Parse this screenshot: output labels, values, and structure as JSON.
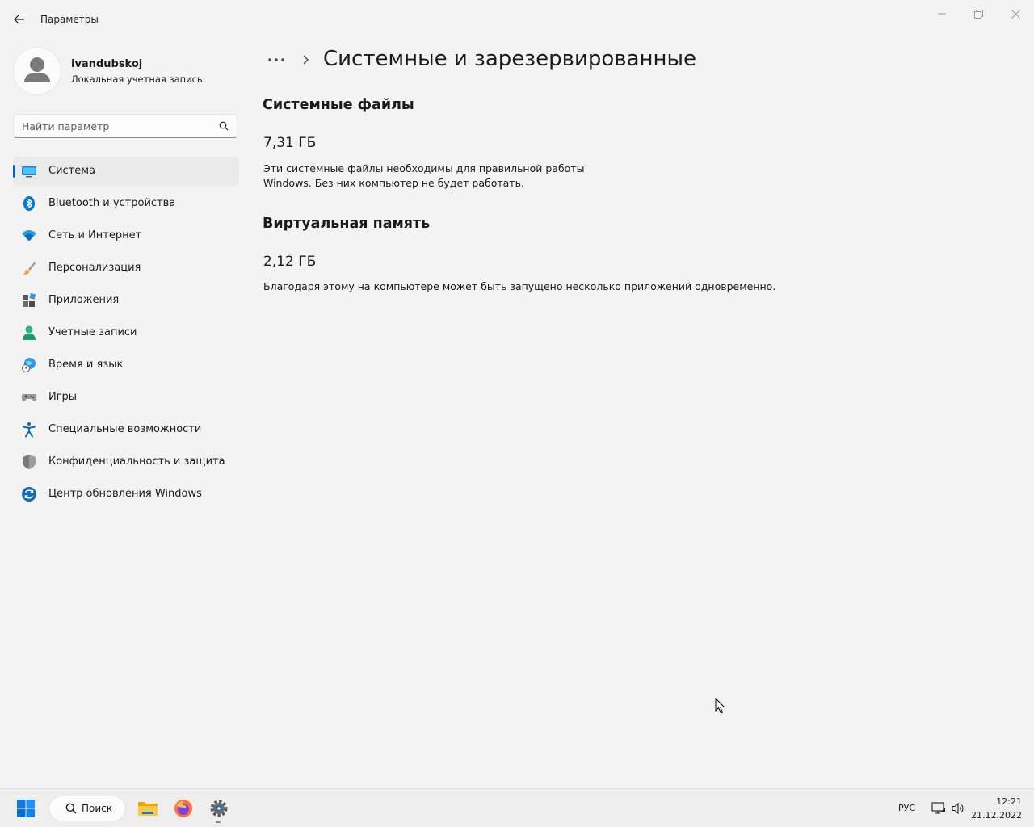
{
  "window": {
    "app_title": "Параметры"
  },
  "profile": {
    "name": "ivandubskoj",
    "account_type": "Локальная учетная запись"
  },
  "search": {
    "placeholder": "Найти параметр"
  },
  "nav": {
    "items": [
      {
        "label": "Система",
        "icon": "system-icon",
        "selected": true
      },
      {
        "label": "Bluetooth и устройства",
        "icon": "bluetooth-icon"
      },
      {
        "label": "Сеть и Интернет",
        "icon": "wifi-icon"
      },
      {
        "label": "Персонализация",
        "icon": "brush-icon"
      },
      {
        "label": "Приложения",
        "icon": "apps-icon"
      },
      {
        "label": "Учетные записи",
        "icon": "person-icon"
      },
      {
        "label": "Время и язык",
        "icon": "globe-clock-icon"
      },
      {
        "label": "Игры",
        "icon": "gamepad-icon"
      },
      {
        "label": "Специальные возможности",
        "icon": "accessibility-icon"
      },
      {
        "label": "Конфиденциальность и защита",
        "icon": "shield-icon"
      },
      {
        "label": "Центр обновления Windows",
        "icon": "update-icon"
      }
    ]
  },
  "breadcrumb": {
    "more": "•••",
    "title": "Системные и зарезервированные"
  },
  "sections": [
    {
      "title": "Системные файлы",
      "size": "7,31 ГБ",
      "description_line1": "Эти системные файлы необходимы для правильной работы",
      "description_line2": "Windows. Без них компьютер не будет работать."
    },
    {
      "title": "Виртуальная память",
      "size": "2,12 ГБ",
      "description_line1": "Благодаря этому на компьютере может быть запущено несколько приложений одновременно."
    }
  ],
  "taskbar": {
    "search_label": "Поиск",
    "language": "РУС",
    "time": "12:21",
    "date": "21.12.2022"
  },
  "colors": {
    "accent": "#005fb8",
    "background": "#f3f3f3"
  }
}
